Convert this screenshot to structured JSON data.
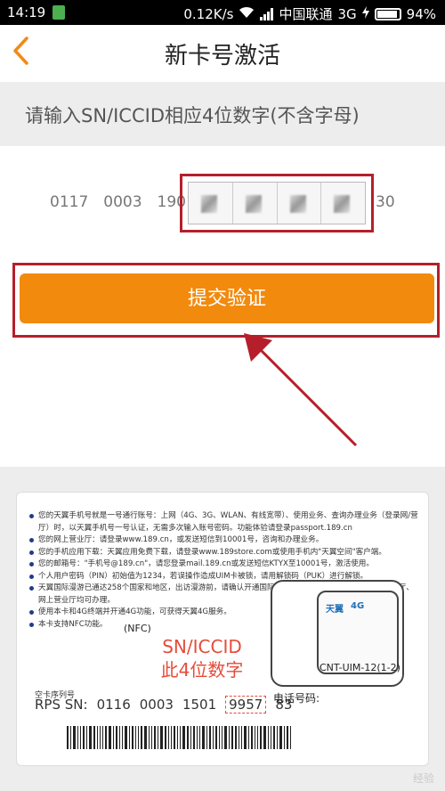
{
  "status_bar": {
    "time": "14:19",
    "network_speed": "0.12K/s",
    "carrier": "中国联通",
    "network_type": "3G",
    "battery": "94%"
  },
  "nav": {
    "back_icon": "chevron-left-icon",
    "title": "新卡号激活"
  },
  "hint": "请输入SN/ICCID相应4位数字(不含字母)",
  "sn_input": {
    "prefix_groups": [
      "0117",
      "0003",
      "1901"
    ],
    "suffix": "30",
    "digit_count": 4
  },
  "submit_label": "提交验证",
  "sim_card": {
    "bullets": [
      "您的天翼手机号就是一号通行账号：上网（4G、3G、WLAN、有线宽带）、使用业务、查询办理业务（登录网/营厅）时，以天翼手机号一号认证，无需多次输入账号密码。功能体验请登录passport.189.cn",
      "您的网上营业厅：请登录www.189.cn，或发送短信到10001号，咨询和办理业务。",
      "您的手机应用下载：天翼应用免费下载，请登录www.189store.com或使用手机内\"天翼空间\"客户端。",
      "您的邮箱号：\"手机号@189.cn\"，请您登录mail.189.cn或发送短信KTYX至10001号，激活使用。",
      "个人用户密码（PIN）初始值为1234，若误操作造成UIM卡被锁，请用解锁码（PUK）进行解锁。",
      "天翼国际漫游已通达258个国家和地区，出访漫游前，请确认开通国际漫游服务，10000号客服热线、营业厅、网上营业厅均可办理。",
      "使用本卡和4G终端并开通4G功能，可获得天翼4G服务。",
      "本卡支持NFC功能。"
    ],
    "nfc_label": "(NFC)",
    "chip_brand": "天翼",
    "chip_4g": "4G",
    "model": "CNT-UIM-12(1-2)",
    "callout_line1": "SN/ICCID",
    "callout_line2": "此4位数字",
    "serial_label": "空卡序列号",
    "rps_label": "RPS SN:",
    "rps_groups": [
      "0116",
      "0003",
      "1501"
    ],
    "rps_highlight": "9957",
    "rps_suffix": "83",
    "phone_label": "电话号码:"
  },
  "watermark": "经验"
}
